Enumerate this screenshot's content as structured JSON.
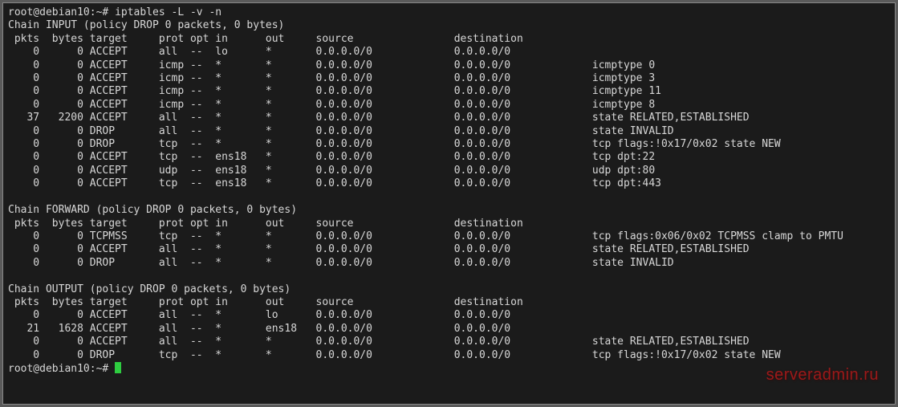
{
  "prompt1": {
    "user": "root@debian10",
    "path": "~",
    "sep": ":",
    "hash": "#",
    "cmd": "iptables -L -v -n"
  },
  "prompt2": {
    "user": "root@debian10",
    "path": "~",
    "sep": ":",
    "hash": "#",
    "cmd": ""
  },
  "colWidths": {
    "pkts": 5,
    "bytes": 6,
    "target": 10,
    "prot": 5,
    "opt": 4,
    "in": 7,
    "out": 8,
    "source": 22,
    "destination": 22
  },
  "headers": {
    "pkts": "pkts",
    "bytes": "bytes",
    "target": "target",
    "prot": "prot",
    "opt": "opt",
    "in": "in",
    "out": "out",
    "source": "source",
    "destination": "destination"
  },
  "chains": [
    {
      "title": "Chain INPUT (policy DROP 0 packets, 0 bytes)",
      "rows": [
        {
          "pkts": "0",
          "bytes": "0",
          "target": "ACCEPT",
          "prot": "all",
          "opt": "--",
          "in": "lo",
          "out": "*",
          "source": "0.0.0.0/0",
          "destination": "0.0.0.0/0",
          "extra": ""
        },
        {
          "pkts": "0",
          "bytes": "0",
          "target": "ACCEPT",
          "prot": "icmp",
          "opt": "--",
          "in": "*",
          "out": "*",
          "source": "0.0.0.0/0",
          "destination": "0.0.0.0/0",
          "extra": "icmptype 0"
        },
        {
          "pkts": "0",
          "bytes": "0",
          "target": "ACCEPT",
          "prot": "icmp",
          "opt": "--",
          "in": "*",
          "out": "*",
          "source": "0.0.0.0/0",
          "destination": "0.0.0.0/0",
          "extra": "icmptype 3"
        },
        {
          "pkts": "0",
          "bytes": "0",
          "target": "ACCEPT",
          "prot": "icmp",
          "opt": "--",
          "in": "*",
          "out": "*",
          "source": "0.0.0.0/0",
          "destination": "0.0.0.0/0",
          "extra": "icmptype 11"
        },
        {
          "pkts": "0",
          "bytes": "0",
          "target": "ACCEPT",
          "prot": "icmp",
          "opt": "--",
          "in": "*",
          "out": "*",
          "source": "0.0.0.0/0",
          "destination": "0.0.0.0/0",
          "extra": "icmptype 8"
        },
        {
          "pkts": "37",
          "bytes": "2200",
          "target": "ACCEPT",
          "prot": "all",
          "opt": "--",
          "in": "*",
          "out": "*",
          "source": "0.0.0.0/0",
          "destination": "0.0.0.0/0",
          "extra": "state RELATED,ESTABLISHED"
        },
        {
          "pkts": "0",
          "bytes": "0",
          "target": "DROP",
          "prot": "all",
          "opt": "--",
          "in": "*",
          "out": "*",
          "source": "0.0.0.0/0",
          "destination": "0.0.0.0/0",
          "extra": "state INVALID"
        },
        {
          "pkts": "0",
          "bytes": "0",
          "target": "DROP",
          "prot": "tcp",
          "opt": "--",
          "in": "*",
          "out": "*",
          "source": "0.0.0.0/0",
          "destination": "0.0.0.0/0",
          "extra": "tcp flags:!0x17/0x02 state NEW"
        },
        {
          "pkts": "0",
          "bytes": "0",
          "target": "ACCEPT",
          "prot": "tcp",
          "opt": "--",
          "in": "ens18",
          "out": "*",
          "source": "0.0.0.0/0",
          "destination": "0.0.0.0/0",
          "extra": "tcp dpt:22"
        },
        {
          "pkts": "0",
          "bytes": "0",
          "target": "ACCEPT",
          "prot": "udp",
          "opt": "--",
          "in": "ens18",
          "out": "*",
          "source": "0.0.0.0/0",
          "destination": "0.0.0.0/0",
          "extra": "udp dpt:80"
        },
        {
          "pkts": "0",
          "bytes": "0",
          "target": "ACCEPT",
          "prot": "tcp",
          "opt": "--",
          "in": "ens18",
          "out": "*",
          "source": "0.0.0.0/0",
          "destination": "0.0.0.0/0",
          "extra": "tcp dpt:443"
        }
      ]
    },
    {
      "title": "Chain FORWARD (policy DROP 0 packets, 0 bytes)",
      "rows": [
        {
          "pkts": "0",
          "bytes": "0",
          "target": "TCPMSS",
          "prot": "tcp",
          "opt": "--",
          "in": "*",
          "out": "*",
          "source": "0.0.0.0/0",
          "destination": "0.0.0.0/0",
          "extra": "tcp flags:0x06/0x02 TCPMSS clamp to PMTU"
        },
        {
          "pkts": "0",
          "bytes": "0",
          "target": "ACCEPT",
          "prot": "all",
          "opt": "--",
          "in": "*",
          "out": "*",
          "source": "0.0.0.0/0",
          "destination": "0.0.0.0/0",
          "extra": "state RELATED,ESTABLISHED"
        },
        {
          "pkts": "0",
          "bytes": "0",
          "target": "DROP",
          "prot": "all",
          "opt": "--",
          "in": "*",
          "out": "*",
          "source": "0.0.0.0/0",
          "destination": "0.0.0.0/0",
          "extra": "state INVALID"
        }
      ]
    },
    {
      "title": "Chain OUTPUT (policy DROP 0 packets, 0 bytes)",
      "rows": [
        {
          "pkts": "0",
          "bytes": "0",
          "target": "ACCEPT",
          "prot": "all",
          "opt": "--",
          "in": "*",
          "out": "lo",
          "source": "0.0.0.0/0",
          "destination": "0.0.0.0/0",
          "extra": ""
        },
        {
          "pkts": "21",
          "bytes": "1628",
          "target": "ACCEPT",
          "prot": "all",
          "opt": "--",
          "in": "*",
          "out": "ens18",
          "source": "0.0.0.0/0",
          "destination": "0.0.0.0/0",
          "extra": ""
        },
        {
          "pkts": "0",
          "bytes": "0",
          "target": "ACCEPT",
          "prot": "all",
          "opt": "--",
          "in": "*",
          "out": "*",
          "source": "0.0.0.0/0",
          "destination": "0.0.0.0/0",
          "extra": "state RELATED,ESTABLISHED"
        },
        {
          "pkts": "0",
          "bytes": "0",
          "target": "DROP",
          "prot": "tcp",
          "opt": "--",
          "in": "*",
          "out": "*",
          "source": "0.0.0.0/0",
          "destination": "0.0.0.0/0",
          "extra": "tcp flags:!0x17/0x02 state NEW"
        }
      ]
    }
  ],
  "watermark": "serveradmin.ru"
}
